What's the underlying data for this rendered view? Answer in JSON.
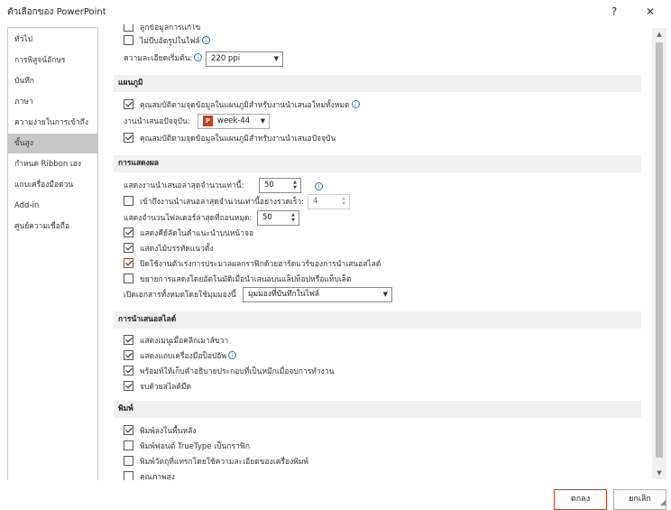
{
  "window": {
    "title": "ตัวเลือกของ PowerPoint",
    "help_glyph": "?",
    "close_glyph": "✕"
  },
  "sidebar": {
    "items": [
      {
        "label": "ทั่วไป"
      },
      {
        "label": "การพิสูจน์อักษร"
      },
      {
        "label": "บันทึก"
      },
      {
        "label": "ภาษา"
      },
      {
        "label": "ความง่ายในการเข้าถึง"
      },
      {
        "label": "ขั้นสูง",
        "selected": true
      },
      {
        "label": "กำหนด Ribbon เอง"
      },
      {
        "label": "แถบเครื่องมือด่วน"
      },
      {
        "label": "Add-in"
      },
      {
        "label": "ศูนย์ความเชื่อถือ"
      }
    ]
  },
  "image_section": {
    "row_partial": "ลูกข้อมูลการแก้ไข",
    "no_compress": "ไม่บีบอัดรูปในไฟล์",
    "resolution_label": "ความละเอียดเริ่มต้น:",
    "resolution_value": "220 ppi"
  },
  "chart_section": {
    "heading": "แผนภูมิ",
    "all_new": "คุณสมบัติตามจุดข้อมูลในแผนภูมิสำหรับงานนำเสนอใหม่ทั้งหมด",
    "current_label": "งานนำเสนอปัจจุบัน:",
    "current_value": "week-44",
    "current_prop": "คุณสมบัติตามจุดข้อมูลในแผนภูมิสำหรับงานนำเสนอปัจจุบัน"
  },
  "display_section": {
    "heading": "การแสดงผล",
    "recent_label": "แสดงงานนำเสนอล่าสุดจำนวนเท่านี้:",
    "recent_value": "50",
    "quick_access_label": "เข้าถึงงานนำเสนอล่าสุดจำนวนเท่านี้อย่างรวดเร็ว:",
    "quick_access_value": "4",
    "unpinned_label": "แสดงจำนวนโฟลเดอร์ล่าสุดที่ถอนหมุด:",
    "unpinned_value": "50",
    "shortcut_keys": "แสดงคีย์ลัดในคำแนะนำบนหน้าจอ",
    "vertical_ruler": "แสดงไม้บรรทัดแนวตั้ง",
    "disable_hw": "ปิดใช้งานตัวเร่งการประมวลผลกราฟิกด้วยฮาร์ดแวร์ของการนำเสนอสไลด์",
    "auto_extend": "ขยายการแสดงโดยอัตโนมัติเมื่อนำเสนอบนแล็ปท็อปหรือแท็บเล็ต",
    "open_view_label": "เปิดเอกสารทั้งหมดโดยใช้มุมมองนี้",
    "open_view_value": "มุมมองที่บันทึกในไฟล์"
  },
  "slideshow_section": {
    "heading": "การนำเสนอสไลด์",
    "right_click": "แสดงเมนูเมื่อคลิกเมาส์ขวา",
    "popup_toolbar": "แสดงแถบเครื่องมือป็อปอัพ",
    "keep_ink": "พร้อมท์ให้เก็บคำอธิบายประกอบที่เป็นหมึกเมื่อจบการทำงาน",
    "black_slide": "จบด้วยสไลด์มืด"
  },
  "print_section": {
    "heading": "พิมพ์",
    "background": "พิมพ์ลงในพื้นหลัง",
    "truetype": "พิมพ์ฟอนต์ TrueType เป็นกราฟิก",
    "inserted_obj": "พิมพ์วัตถุที่แทรกโดยใช้ความละเอียดของเครื่องพิมพ์",
    "high_quality": "คุณภาพสูง"
  },
  "footer": {
    "ok": "ตกลง",
    "cancel": "ยกเลิก"
  },
  "icons": {
    "info": "i",
    "dropdown": "▼",
    "spin_up": "▲",
    "spin_down": "▼",
    "ppt": "P",
    "scroll_up": "▲",
    "scroll_down": "▼",
    "resize": "◢"
  }
}
